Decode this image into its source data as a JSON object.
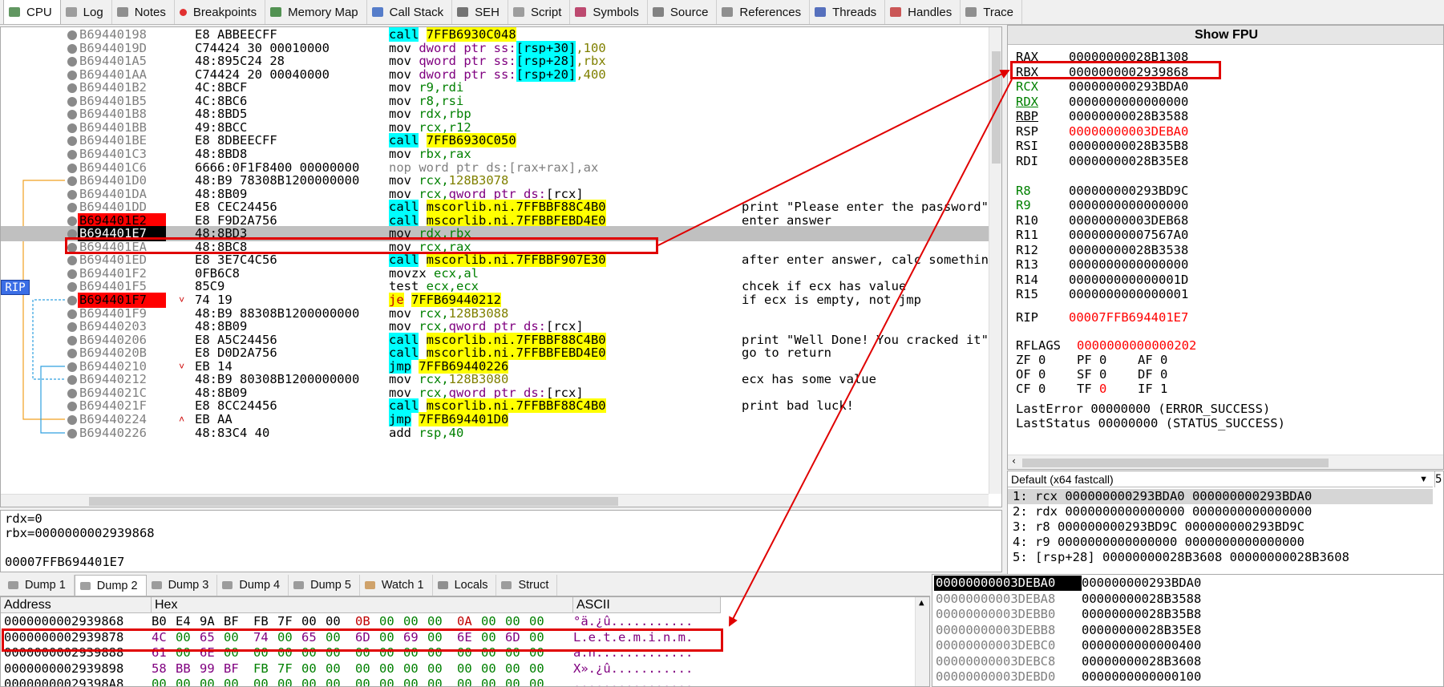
{
  "tabs": [
    {
      "label": "CPU",
      "icon": "cpu-icon",
      "active": true
    },
    {
      "label": "Log",
      "icon": "log-icon"
    },
    {
      "label": "Notes",
      "icon": "notes-icon"
    },
    {
      "label": "Breakpoints",
      "icon": "breakpoint-icon"
    },
    {
      "label": "Memory Map",
      "icon": "memory-map-icon"
    },
    {
      "label": "Call Stack",
      "icon": "call-stack-icon"
    },
    {
      "label": "SEH",
      "icon": "seh-icon"
    },
    {
      "label": "Script",
      "icon": "script-icon"
    },
    {
      "label": "Symbols",
      "icon": "symbols-icon"
    },
    {
      "label": "Source",
      "icon": "source-icon"
    },
    {
      "label": "References",
      "icon": "references-icon"
    },
    {
      "label": "Threads",
      "icon": "threads-icon"
    },
    {
      "label": "Handles",
      "icon": "handles-icon"
    },
    {
      "label": "Trace",
      "icon": "trace-icon"
    }
  ],
  "rip_label": "RIP",
  "disasm": [
    {
      "addr": "B69440198",
      "bytes": "E8 ABBEECFF",
      "mn": "call",
      "ops": "7FFB6930C048",
      "kind": "call",
      "comment": ""
    },
    {
      "addr": "B6944019D",
      "bytes": "C74424 30 00010000",
      "mn": "mov",
      "ops": "dword ptr ss:[rsp+30],100",
      "kind": "movmem",
      "comment": ""
    },
    {
      "addr": "B694401A5",
      "bytes": "48:895C24 28",
      "mn": "mov",
      "ops": "qword ptr ss:[rsp+28],rbx",
      "kind": "movmem",
      "comment": ""
    },
    {
      "addr": "B694401AA",
      "bytes": "C74424 20 00040000",
      "mn": "mov",
      "ops": "dword ptr ss:[rsp+20],400",
      "kind": "movmem",
      "comment": ""
    },
    {
      "addr": "B694401B2",
      "bytes": "4C:8BCF",
      "mn": "mov",
      "ops": "r9,rdi",
      "kind": "mov",
      "comment": ""
    },
    {
      "addr": "B694401B5",
      "bytes": "4C:8BC6",
      "mn": "mov",
      "ops": "r8,rsi",
      "kind": "mov",
      "comment": ""
    },
    {
      "addr": "B694401B8",
      "bytes": "48:8BD5",
      "mn": "mov",
      "ops": "rdx,rbp",
      "kind": "mov",
      "comment": ""
    },
    {
      "addr": "B694401BB",
      "bytes": "49:8BCC",
      "mn": "mov",
      "ops": "rcx,r12",
      "kind": "mov",
      "comment": ""
    },
    {
      "addr": "B694401BE",
      "bytes": "E8 8DBEECFF",
      "mn": "call",
      "ops": "7FFB6930C050",
      "kind": "call",
      "comment": ""
    },
    {
      "addr": "B694401C3",
      "bytes": "48:8BD8",
      "mn": "mov",
      "ops": "rbx,rax",
      "kind": "mov",
      "comment": ""
    },
    {
      "addr": "B694401C6",
      "bytes": "6666:0F1F8400 00000000",
      "mn": "nop",
      "ops": "word ptr ds:[rax+rax],ax",
      "kind": "nop",
      "comment": ""
    },
    {
      "addr": "B694401D0",
      "bytes": "48:B9 78308B1200000000",
      "mn": "mov",
      "ops": "rcx,128B3078",
      "kind": "movimm",
      "comment": ""
    },
    {
      "addr": "B694401DA",
      "bytes": "48:8B09",
      "mn": "mov",
      "ops": "rcx,qword ptr ds:[rcx]",
      "kind": "movptr",
      "comment": ""
    },
    {
      "addr": "B694401DD",
      "bytes": "E8 CEC24456",
      "mn": "call",
      "ops": "mscorlib.ni.7FFBBF88C4B0",
      "kind": "call",
      "comment": "print \"Please enter the password\""
    },
    {
      "addr": "B694401E2",
      "bytes": "E8 F9D2A756",
      "mn": "call",
      "ops": "mscorlib.ni.7FFBBFEBD4E0",
      "kind": "call",
      "comment": "enter answer",
      "bp": true
    },
    {
      "addr": "B694401E7",
      "bytes": "48:8BD3",
      "mn": "mov",
      "ops": "rdx,rbx",
      "kind": "mov",
      "comment": "",
      "current": true
    },
    {
      "addr": "B694401EA",
      "bytes": "48:8BC8",
      "mn": "mov",
      "ops": "rcx,rax",
      "kind": "mov",
      "comment": ""
    },
    {
      "addr": "B694401ED",
      "bytes": "E8 3E7C4C56",
      "mn": "call",
      "ops": "mscorlib.ni.7FFBBF907E30",
      "kind": "call",
      "comment": "after enter answer, calc something"
    },
    {
      "addr": "B694401F2",
      "bytes": "0FB6C8",
      "mn": "movzx",
      "ops": "ecx,al",
      "kind": "mov",
      "comment": ""
    },
    {
      "addr": "B694401F5",
      "bytes": "85C9",
      "mn": "test",
      "ops": "ecx,ecx",
      "kind": "mov",
      "comment": "chcek if ecx has value"
    },
    {
      "addr": "B694401F7",
      "bytes": "74 19",
      "mn": "je",
      "ops": "7FFB69440212",
      "kind": "je",
      "comment": "if ecx is empty, not jmp",
      "bp": true,
      "arrow": "down"
    },
    {
      "addr": "B694401F9",
      "bytes": "48:B9 88308B1200000000",
      "mn": "mov",
      "ops": "rcx,128B3088",
      "kind": "movimm",
      "comment": ""
    },
    {
      "addr": "B69440203",
      "bytes": "48:8B09",
      "mn": "mov",
      "ops": "rcx,qword ptr ds:[rcx]",
      "kind": "movptr",
      "comment": ""
    },
    {
      "addr": "B69440206",
      "bytes": "E8 A5C24456",
      "mn": "call",
      "ops": "mscorlib.ni.7FFBBF88C4B0",
      "kind": "call",
      "comment": "print \"Well Done! You cracked it\""
    },
    {
      "addr": "B6944020B",
      "bytes": "E8 D0D2A756",
      "mn": "call",
      "ops": "mscorlib.ni.7FFBBFEBD4E0",
      "kind": "call",
      "comment": "go to return"
    },
    {
      "addr": "B69440210",
      "bytes": "EB 14",
      "mn": "jmp",
      "ops": "7FFB69440226",
      "kind": "jmp",
      "comment": "",
      "arrow": "down"
    },
    {
      "addr": "B69440212",
      "bytes": "48:B9 80308B1200000000",
      "mn": "mov",
      "ops": "rcx,128B3080",
      "kind": "movimm",
      "comment": "ecx has some value"
    },
    {
      "addr": "B6944021C",
      "bytes": "48:8B09",
      "mn": "mov",
      "ops": "rcx,qword ptr ds:[rcx]",
      "kind": "movptr",
      "comment": ""
    },
    {
      "addr": "B6944021F",
      "bytes": "E8 8CC24456",
      "mn": "call",
      "ops": "mscorlib.ni.7FFBBF88C4B0",
      "kind": "call",
      "comment": "print bad luck!"
    },
    {
      "addr": "B69440224",
      "bytes": "EB AA",
      "mn": "jmp",
      "ops": "7FFB694401D0",
      "kind": "jmp",
      "comment": "",
      "arrow": "up"
    },
    {
      "addr": "B69440226",
      "bytes": "48:83C4 40",
      "mn": "add",
      "ops": "rsp,40",
      "kind": "mov",
      "comment": ""
    }
  ],
  "info": [
    "rdx=0",
    "rbx=0000000002939868",
    "",
    "00007FFB694401E7"
  ],
  "registers": {
    "show_fpu": "Show FPU",
    "rows": [
      {
        "name": "RAX",
        "val": "00000000028B1308"
      },
      {
        "name": "RBX",
        "val": "0000000002939868"
      },
      {
        "name": "RCX",
        "val": "000000000293BDA0",
        "chg": true
      },
      {
        "name": "RDX",
        "val": "0000000000000000",
        "chg": true
      },
      {
        "name": "RBP",
        "val": "00000000028B3588"
      },
      {
        "name": "RSP",
        "val": "00000000003DEBA0",
        "red": true
      },
      {
        "name": "RSI",
        "val": "00000000028B35B8"
      },
      {
        "name": "RDI",
        "val": "00000000028B35E8"
      },
      {
        "name": "",
        "val": ""
      },
      {
        "name": "R8",
        "val": "000000000293BD9C",
        "chg": true
      },
      {
        "name": "R9",
        "val": "0000000000000000",
        "chg": true
      },
      {
        "name": "R10",
        "val": "00000000003DEB68"
      },
      {
        "name": "R11",
        "val": "00000000007567A0"
      },
      {
        "name": "R12",
        "val": "00000000028B3538"
      },
      {
        "name": "R13",
        "val": "0000000000000000"
      },
      {
        "name": "R14",
        "val": "000000000000001D"
      },
      {
        "name": "R15",
        "val": "0000000000000001"
      }
    ],
    "rip_name": "RIP",
    "rip_val": "00007FFB694401E7",
    "rflags_name": "RFLAGS",
    "rflags_val": "0000000000000202",
    "flags": [
      [
        "ZF 0",
        "PF 0",
        "AF 0"
      ],
      [
        "OF 0",
        "SF 0",
        "DF 0"
      ],
      [
        "CF 0",
        "TF 0",
        "IF 1"
      ]
    ],
    "last_error": "LastError  00000000 (ERROR_SUCCESS)",
    "last_status": "LastStatus 00000000 (STATUS_SUCCESS)"
  },
  "callconv": {
    "select": "Default (x64 fastcall)",
    "num": "5",
    "rows": [
      "1: rcx 000000000293BDA0 000000000293BDA0",
      "2: rdx 0000000000000000 0000000000000000",
      "3: r8 000000000293BD9C 000000000293BD9C",
      "4: r9 0000000000000000 0000000000000000",
      "5: [rsp+28] 00000000028B3608 00000000028B3608"
    ]
  },
  "dump_tabs": [
    {
      "label": "Dump 1",
      "icon": "dump-icon"
    },
    {
      "label": "Dump 2",
      "icon": "dump-icon",
      "active": true
    },
    {
      "label": "Dump 3",
      "icon": "dump-icon"
    },
    {
      "label": "Dump 4",
      "icon": "dump-icon"
    },
    {
      "label": "Dump 5",
      "icon": "dump-icon"
    },
    {
      "label": "Watch 1",
      "icon": "watch-icon"
    },
    {
      "label": "Locals",
      "icon": "locals-icon"
    },
    {
      "label": "Struct",
      "icon": "struct-icon"
    }
  ],
  "dump": {
    "headers": [
      "Address",
      "Hex",
      "ASCII"
    ],
    "rows": [
      {
        "addr": "0000000002939868",
        "hex": [
          "B0",
          "E4",
          "9A",
          "BF",
          "FB",
          "7F",
          "00",
          "00",
          "0B",
          "00",
          "00",
          "00",
          "0A",
          "00",
          "00",
          "00"
        ],
        "ascii": "°ä.¿û..........."
      },
      {
        "addr": "0000000002939878",
        "hex": [
          "4C",
          "00",
          "65",
          "00",
          "74",
          "00",
          "65",
          "00",
          "6D",
          "00",
          "69",
          "00",
          "6E",
          "00",
          "6D",
          "00"
        ],
        "ascii": "L.e.t.e.m.i.n.m."
      },
      {
        "addr": "0000000002939888",
        "hex": [
          "61",
          "00",
          "6E",
          "00",
          "00",
          "00",
          "00",
          "00",
          "00",
          "00",
          "00",
          "00",
          "00",
          "00",
          "00",
          "00"
        ],
        "ascii": "a.n............."
      },
      {
        "addr": "0000000002939898",
        "hex": [
          "58",
          "BB",
          "99",
          "BF",
          "FB",
          "7F",
          "00",
          "00",
          "00",
          "00",
          "00",
          "00",
          "00",
          "00",
          "00",
          "00"
        ],
        "ascii": "X».¿û..........."
      },
      {
        "addr": "00000000029398A8",
        "hex": [
          "00",
          "00",
          "00",
          "00",
          "00",
          "00",
          "00",
          "00",
          "00",
          "00",
          "00",
          "00",
          "00",
          "00",
          "00",
          "00"
        ],
        "ascii": "................"
      }
    ]
  },
  "stack": [
    {
      "addr": "00000000003DEBA0",
      "val": "000000000293BDA0",
      "top": true
    },
    {
      "addr": "00000000003DEBA8",
      "val": "00000000028B3588"
    },
    {
      "addr": "00000000003DEBB0",
      "val": "00000000028B35B8"
    },
    {
      "addr": "00000000003DEBB8",
      "val": "00000000028B35E8"
    },
    {
      "addr": "00000000003DEBC0",
      "val": "0000000000000400"
    },
    {
      "addr": "00000000003DEBC8",
      "val": "00000000028B3608"
    },
    {
      "addr": "00000000003DEBD0",
      "val": "0000000000000100"
    }
  ],
  "colors": {
    "highlight_box": "#e00000",
    "call_bg": "#ffff00",
    "ptr_bg": "#00ffff",
    "breakpoint": "#ff0000"
  }
}
